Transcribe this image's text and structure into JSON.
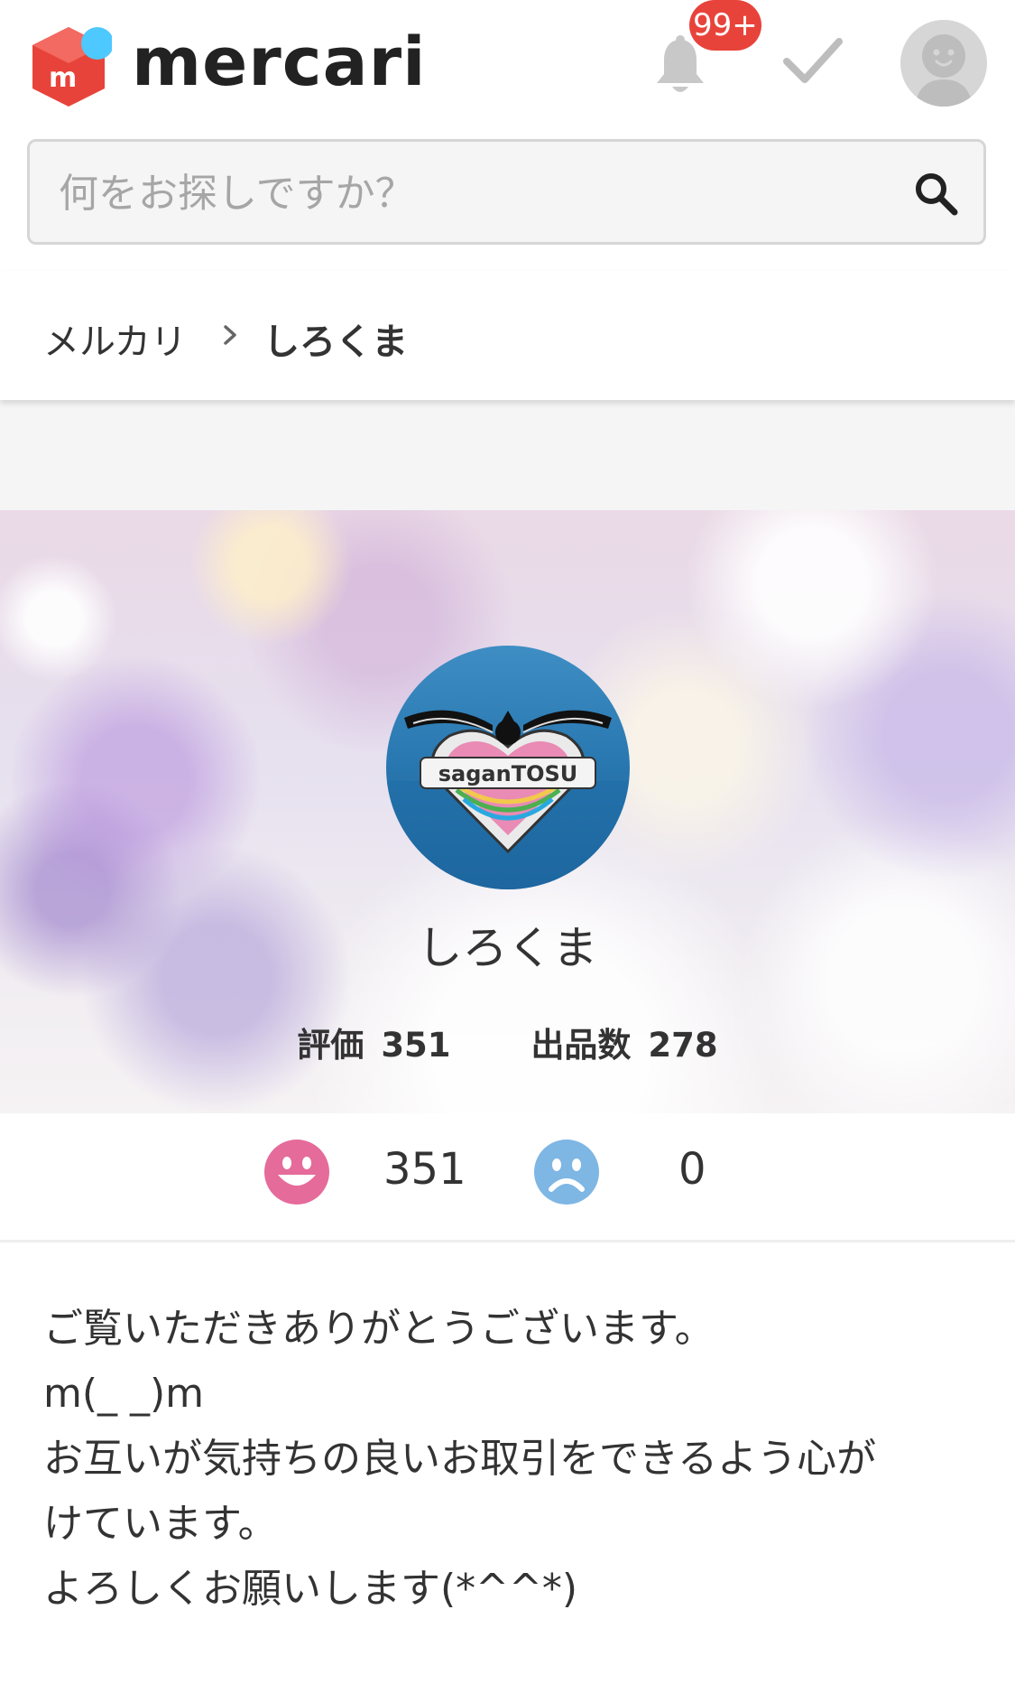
{
  "header": {
    "logo_text": "mercari",
    "notifications_badge": "99+"
  },
  "search": {
    "placeholder": "何をお探しですか？"
  },
  "breadcrumb": {
    "home": "メルカリ",
    "current": "しろくま"
  },
  "profile": {
    "name": "しろくま",
    "rating_label": "評価",
    "rating_count": "351",
    "listings_label": "出品数",
    "listings_count": "278",
    "avatar_logo_text": "saganTOSU",
    "good_count": "351",
    "bad_count": "0",
    "bio_lines": [
      "ご覧いただきありがとうございます。",
      "m(_ _)m",
      "お互いが気持ちの良いお取引をできるよう心が",
      "けています。",
      "よろしくお願いします(*^^*)"
    ]
  },
  "colors": {
    "brand_red": "#e8433a",
    "brand_blue": "#4dc9ff",
    "good_face": "#e56b9a",
    "bad_face": "#7eb6e4"
  },
  "icons": [
    "bell-icon",
    "check-icon",
    "user-avatar-icon",
    "search-icon",
    "chevron-right-icon",
    "smile-face-icon",
    "sad-face-icon"
  ]
}
